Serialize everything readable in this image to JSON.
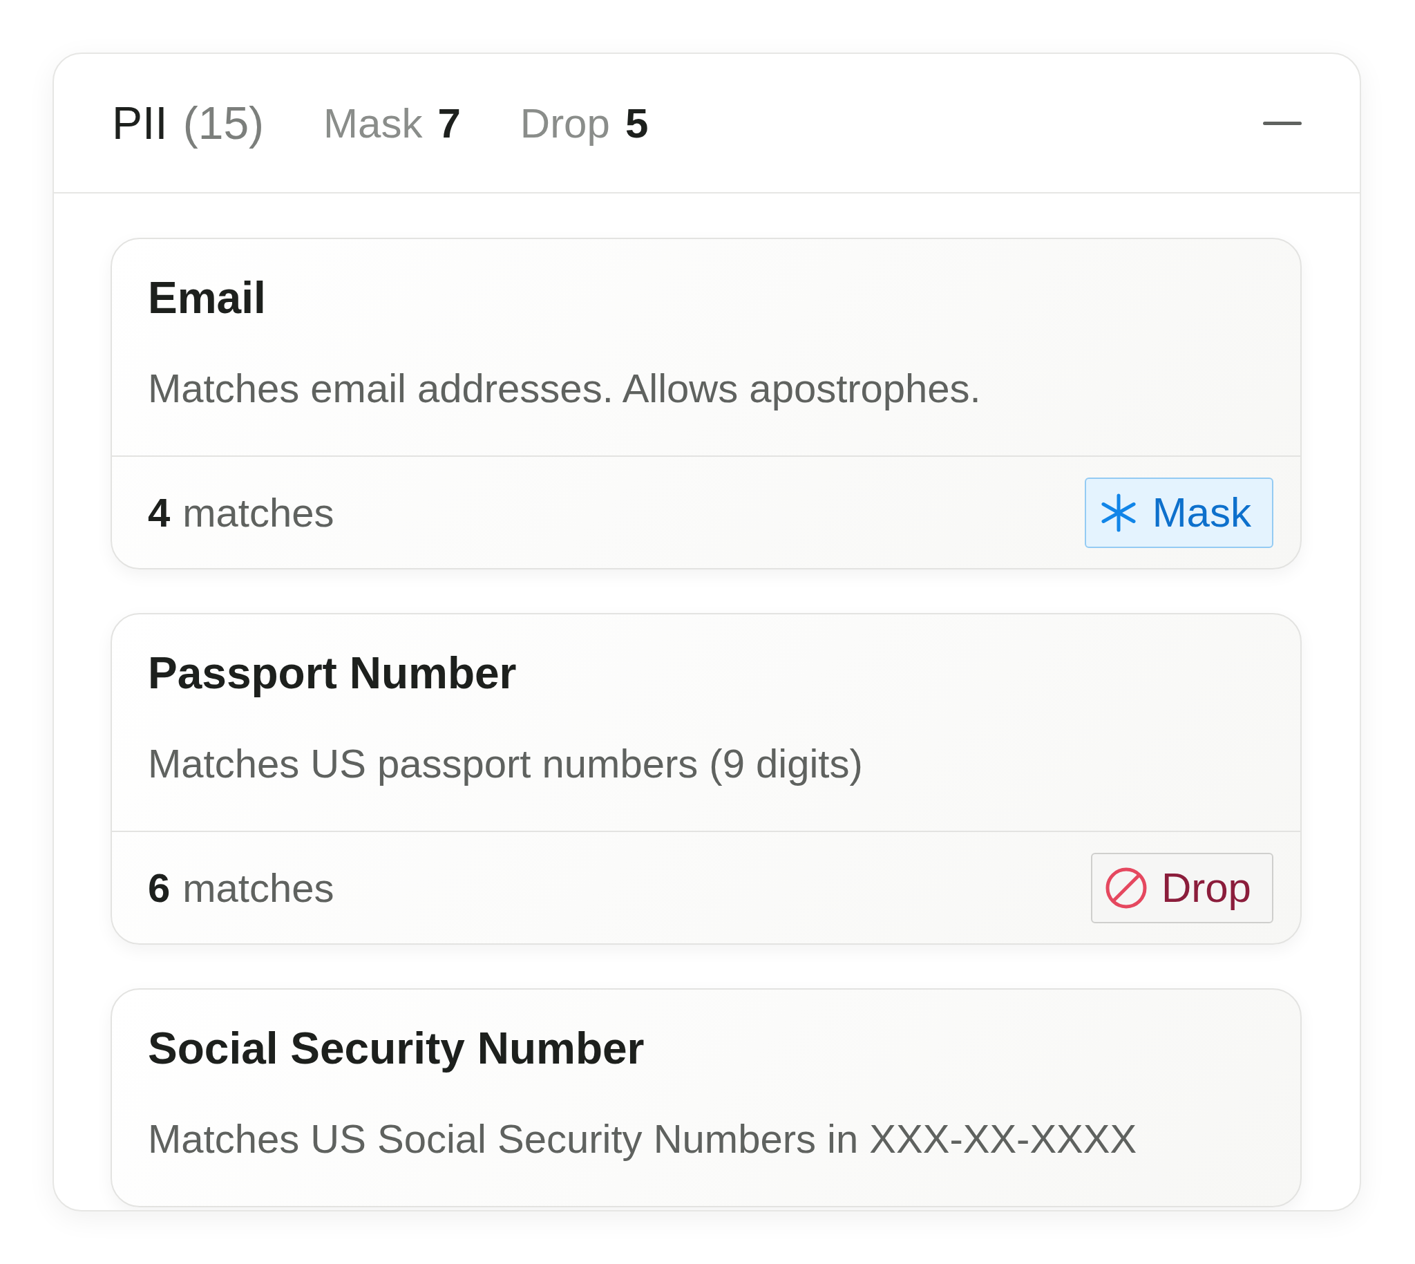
{
  "header": {
    "title": "PII",
    "count": "(15)",
    "stats": [
      {
        "label": "Mask",
        "value": "7"
      },
      {
        "label": "Drop",
        "value": "5"
      }
    ],
    "expanded": true
  },
  "rules": [
    {
      "name": "Email",
      "description": "Matches email addresses. Allows apostrophes.",
      "matches_count": "4",
      "matches_label": "matches",
      "action": {
        "kind": "mask",
        "label": "Mask"
      }
    },
    {
      "name": "Passport Number",
      "description": "Matches US passport numbers (9 digits)",
      "matches_count": "6",
      "matches_label": "matches",
      "action": {
        "kind": "drop",
        "label": "Drop"
      }
    },
    {
      "name": "Social Security Number",
      "description": "Matches US Social Security Numbers in XXX-XX-XXXX"
    }
  ]
}
